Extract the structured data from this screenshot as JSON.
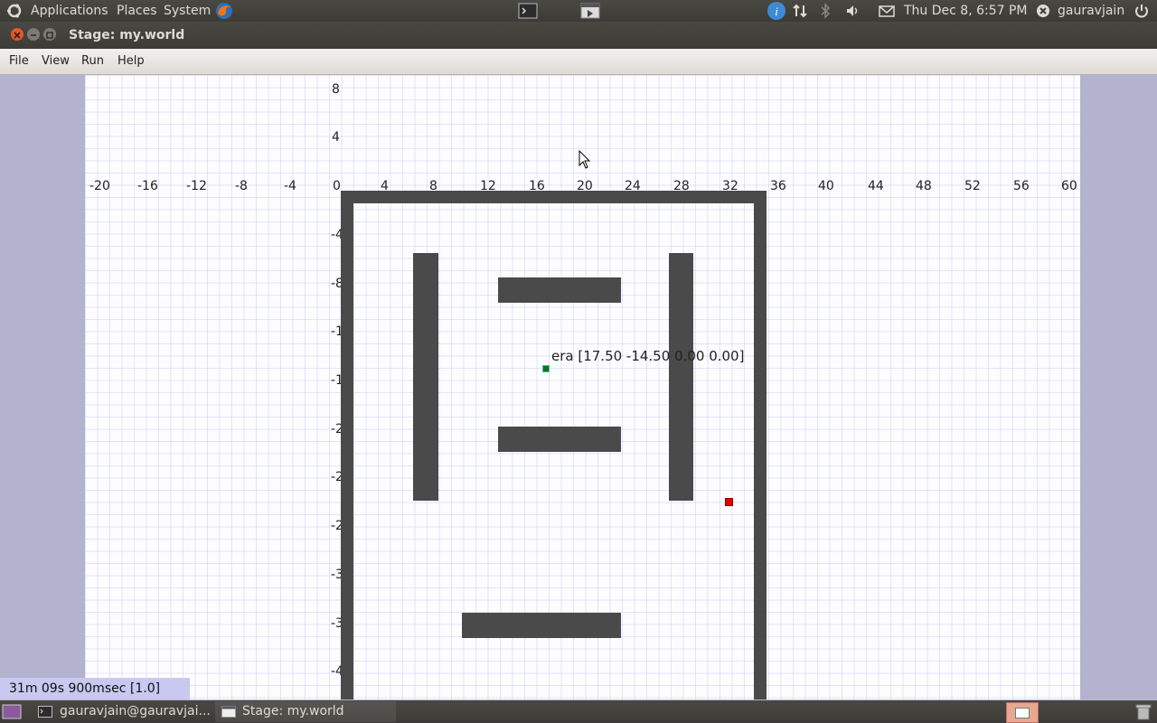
{
  "top_panel": {
    "applications": "Applications",
    "places": "Places",
    "system": "System",
    "clock": "Thu Dec  8,  6:57 PM",
    "user": "gauravjain",
    "icons": [
      "ubuntu-logo-icon",
      "firefox-icon",
      "terminal-icon",
      "window-icon",
      "info-icon",
      "network-icon",
      "bluetooth-icon",
      "volume-icon",
      "mail-icon",
      "user-status-icon",
      "power-icon"
    ]
  },
  "window": {
    "title": "Stage: my.world"
  },
  "menubar": {
    "file": "File",
    "view": "View",
    "run": "Run",
    "help": "Help"
  },
  "canvas": {
    "x_ticks": [
      "-20",
      "-16",
      "-12",
      "-8",
      "-4",
      "0",
      "4",
      "8",
      "12",
      "16",
      "20",
      "24",
      "28",
      "32",
      "36",
      "40",
      "44",
      "48",
      "52",
      "56",
      "60"
    ],
    "y_ticks_pos": [
      "8",
      "4"
    ],
    "y_ticks_neg": [
      "-4",
      "-8",
      "-1",
      "-1",
      "-2",
      "-2",
      "-2",
      "-3",
      "-3",
      "-4"
    ],
    "robot_label": "era [17.50 -14.50 0.00 0.00]",
    "colors": {
      "wall": "#4a4a4a",
      "robot": "#1a6b2a",
      "marker": "#dd0000"
    }
  },
  "status": {
    "time": "31m 09s 900msec [1.0]"
  },
  "taskbar": {
    "items": [
      {
        "label": "gauravjain@gauravjai..."
      },
      {
        "label": "Stage: my.world"
      }
    ]
  }
}
